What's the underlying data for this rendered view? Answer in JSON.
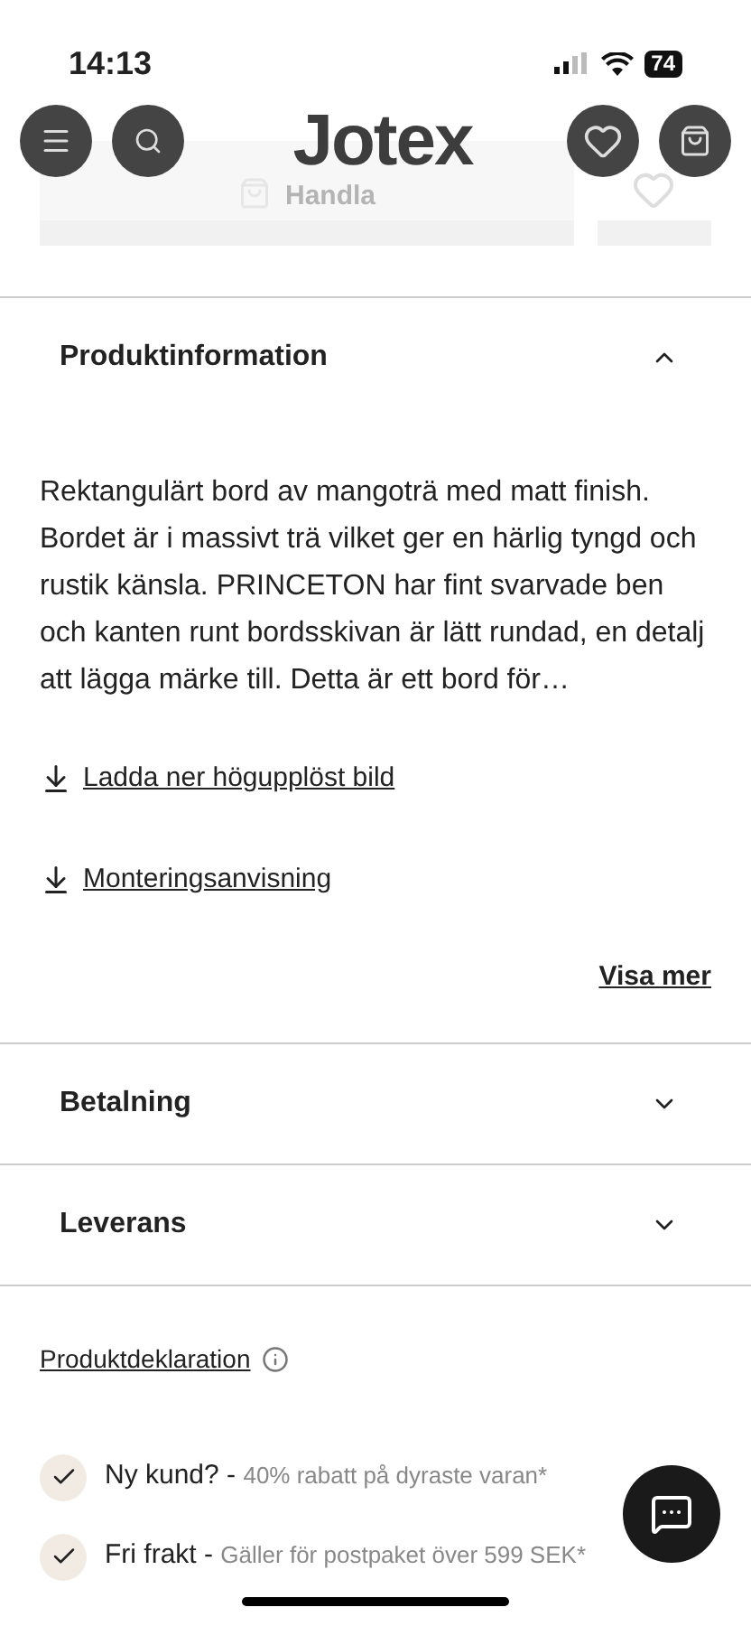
{
  "status_bar": {
    "time": "14:13",
    "battery": "74"
  },
  "header": {
    "logo": "Jotex",
    "behind_button": "Handla"
  },
  "sections": [
    {
      "title": "Produktinformation",
      "expanded": true,
      "text": "Rektangulärt bord av mangoträ med matt finish. Bordet är i massivt trä vilket ger en härlig tyngd och rustik känsla. PRINCETON har fint svarvade ben och kanten runt bordsskivan är lätt rundad, en detalj att lägga märke till. Detta är ett bord för…",
      "links": [
        "Ladda ner högupplöst bild",
        "Monteringsanvisning"
      ],
      "more": "Visa mer"
    },
    {
      "title": "Betalning",
      "expanded": false
    },
    {
      "title": "Leverans",
      "expanded": false
    }
  ],
  "declaration": "Produktdeklaration",
  "usps": [
    {
      "title": "Ny kund? -",
      "detail": "40% rabatt på dyraste varan*"
    },
    {
      "title": "Fri frakt -",
      "detail": "Gäller för postpaket över 599 SEK*"
    }
  ]
}
